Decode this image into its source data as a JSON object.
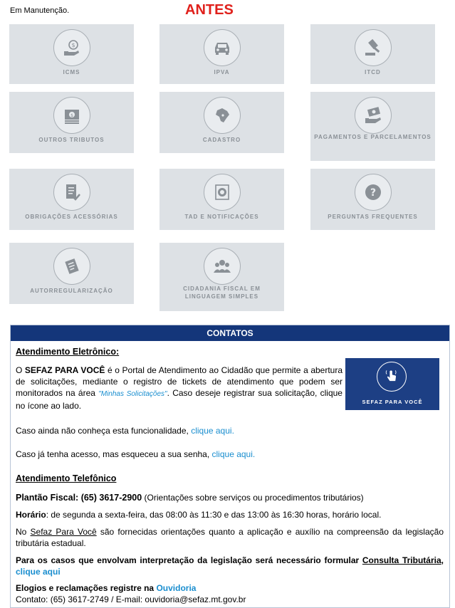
{
  "header": {
    "maintenance_text": "Em Manutenção.",
    "title": "ANTES"
  },
  "tiles": [
    {
      "label": "ICMS",
      "icon": "money-hand-icon"
    },
    {
      "label": "IPVA",
      "icon": "car-icon"
    },
    {
      "label": "ITCD",
      "icon": "gavel-icon"
    },
    {
      "label": "OUTROS TRIBUTOS",
      "icon": "banknote-icon"
    },
    {
      "label": "CADASTRO",
      "icon": "brazil-map-icon"
    },
    {
      "label": "PAGAMENTOS E PARCELAMENTOS",
      "icon": "money-hand-icon"
    },
    {
      "label": "OBRIGAÇÕES ACESSÓRIAS",
      "icon": "document-check-icon"
    },
    {
      "label": "TAD E NOTIFICAÇÕES",
      "icon": "stamp-icon"
    },
    {
      "label": "PERGUNTAS FREQUENTES",
      "icon": "question-icon"
    },
    {
      "label": "AUTORREGULARIZAÇÃO",
      "icon": "document-pen-icon"
    },
    {
      "label": "CIDADANIA FISCAL EM LINGUAGEM SIMPLES",
      "icon": "people-icon"
    }
  ],
  "contacts": {
    "header": "CONTATOS",
    "electronic": {
      "heading": "Atendimento Eletrônico:",
      "p1_prefix": "O ",
      "p1_bold": "SEFAZ PARA VOCÊ",
      "p1_mid": " é o Portal de Atendimento ao Cidadão que permite a abertura de solicitações, mediante o registro de tickets de atendimento que podem ser monitorados na área ",
      "p1_italic": "\"Minhas Solicitações\"",
      "p1_suffix": ". Caso deseje registrar sua solicitação, clique no ícone ao lado.",
      "banner_label": "SEFAZ PARA VOCÊ",
      "p2_text": "Caso ainda não conheça esta funcionalidade, ",
      "p2_link": "clique aqui.",
      "p3_text": "Caso já tenha acesso, mas esqueceu a sua senha, ",
      "p3_link": "clique aqui."
    },
    "phone": {
      "heading": "Atendimento Telefônico",
      "plantao_bold": "Plantão Fiscal: (65) 3617-2900",
      "plantao_rest": " (Orientações sobre serviços ou procedimentos tributários)",
      "horario_bold": "Horário",
      "horario_rest": ": de segunda a sexta-feira, das 08:00 às 11:30 e das 13:00 às 16:30 horas, horário local.",
      "no_prefix": "No ",
      "no_underline": "Sefaz Para Você",
      "no_rest": " são fornecidas orientações quanto a aplicação e auxílio na compreensão da legislação tributária estadual.",
      "interp_bold": "Para os casos que envolvam interpretação da legislação será necessário formular ",
      "interp_link": "Consulta Tributária",
      "interp_comma": ", ",
      "interp_click": "clique aqui",
      "elogios_bold": "Elogios e reclamações registre na ",
      "elogios_link": "Ouvidoria",
      "contato": "Contato: (65) 3617-2749 / E-mail: ouvidoria@sefaz.mt.gov.br"
    }
  }
}
